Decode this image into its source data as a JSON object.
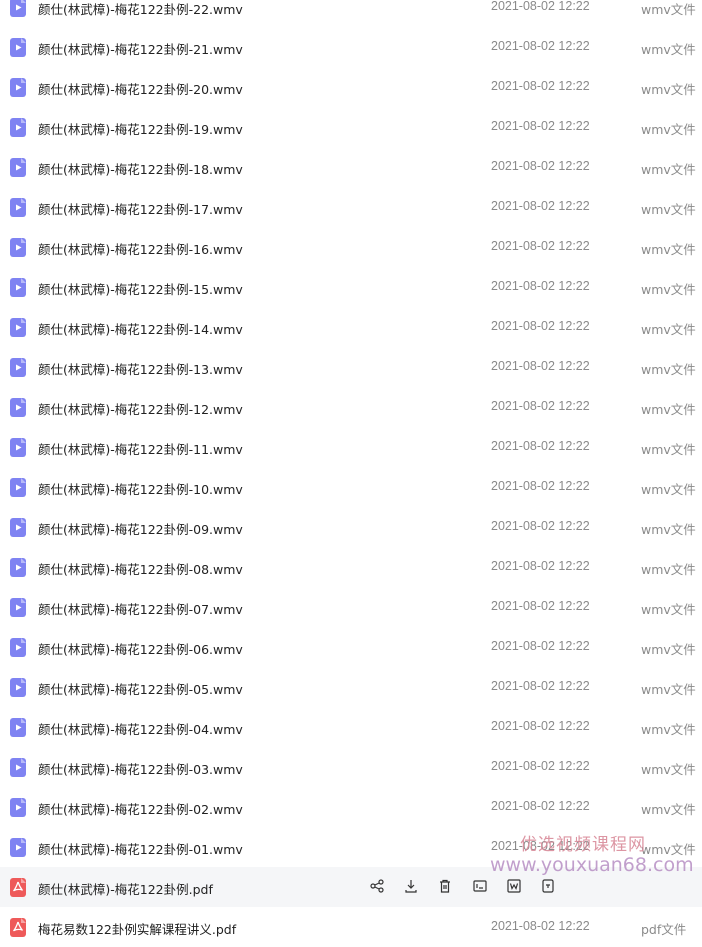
{
  "files": [
    {
      "name": "颜仕(林武樟)-梅花122卦例-22.wmv",
      "date": "2021-08-02 12:22",
      "type": "wmv文件",
      "kind": "video"
    },
    {
      "name": "颜仕(林武樟)-梅花122卦例-21.wmv",
      "date": "2021-08-02 12:22",
      "type": "wmv文件",
      "kind": "video"
    },
    {
      "name": "颜仕(林武樟)-梅花122卦例-20.wmv",
      "date": "2021-08-02 12:22",
      "type": "wmv文件",
      "kind": "video"
    },
    {
      "name": "颜仕(林武樟)-梅花122卦例-19.wmv",
      "date": "2021-08-02 12:22",
      "type": "wmv文件",
      "kind": "video"
    },
    {
      "name": "颜仕(林武樟)-梅花122卦例-18.wmv",
      "date": "2021-08-02 12:22",
      "type": "wmv文件",
      "kind": "video"
    },
    {
      "name": "颜仕(林武樟)-梅花122卦例-17.wmv",
      "date": "2021-08-02 12:22",
      "type": "wmv文件",
      "kind": "video"
    },
    {
      "name": "颜仕(林武樟)-梅花122卦例-16.wmv",
      "date": "2021-08-02 12:22",
      "type": "wmv文件",
      "kind": "video"
    },
    {
      "name": "颜仕(林武樟)-梅花122卦例-15.wmv",
      "date": "2021-08-02 12:22",
      "type": "wmv文件",
      "kind": "video"
    },
    {
      "name": "颜仕(林武樟)-梅花122卦例-14.wmv",
      "date": "2021-08-02 12:22",
      "type": "wmv文件",
      "kind": "video"
    },
    {
      "name": "颜仕(林武樟)-梅花122卦例-13.wmv",
      "date": "2021-08-02 12:22",
      "type": "wmv文件",
      "kind": "video"
    },
    {
      "name": "颜仕(林武樟)-梅花122卦例-12.wmv",
      "date": "2021-08-02 12:22",
      "type": "wmv文件",
      "kind": "video"
    },
    {
      "name": "颜仕(林武樟)-梅花122卦例-11.wmv",
      "date": "2021-08-02 12:22",
      "type": "wmv文件",
      "kind": "video"
    },
    {
      "name": "颜仕(林武樟)-梅花122卦例-10.wmv",
      "date": "2021-08-02 12:22",
      "type": "wmv文件",
      "kind": "video"
    },
    {
      "name": "颜仕(林武樟)-梅花122卦例-09.wmv",
      "date": "2021-08-02 12:22",
      "type": "wmv文件",
      "kind": "video"
    },
    {
      "name": "颜仕(林武樟)-梅花122卦例-08.wmv",
      "date": "2021-08-02 12:22",
      "type": "wmv文件",
      "kind": "video"
    },
    {
      "name": "颜仕(林武樟)-梅花122卦例-07.wmv",
      "date": "2021-08-02 12:22",
      "type": "wmv文件",
      "kind": "video"
    },
    {
      "name": "颜仕(林武樟)-梅花122卦例-06.wmv",
      "date": "2021-08-02 12:22",
      "type": "wmv文件",
      "kind": "video"
    },
    {
      "name": "颜仕(林武樟)-梅花122卦例-05.wmv",
      "date": "2021-08-02 12:22",
      "type": "wmv文件",
      "kind": "video"
    },
    {
      "name": "颜仕(林武樟)-梅花122卦例-04.wmv",
      "date": "2021-08-02 12:22",
      "type": "wmv文件",
      "kind": "video"
    },
    {
      "name": "颜仕(林武樟)-梅花122卦例-03.wmv",
      "date": "2021-08-02 12:22",
      "type": "wmv文件",
      "kind": "video"
    },
    {
      "name": "颜仕(林武樟)-梅花122卦例-02.wmv",
      "date": "2021-08-02 12:22",
      "type": "wmv文件",
      "kind": "video"
    },
    {
      "name": "颜仕(林武樟)-梅花122卦例-01.wmv",
      "date": "2021-08-02 12:22",
      "type": "wmv文件",
      "kind": "video"
    },
    {
      "name": "颜仕(林武樟)-梅花122卦例.pdf",
      "date": "",
      "type": "",
      "kind": "pdf",
      "hovered": true
    },
    {
      "name": "梅花易数122卦例实解课程讲义.pdf",
      "date": "2021-08-02 12:22",
      "type": "pdf文件",
      "kind": "pdf"
    }
  ],
  "row_actions": [
    "share-icon",
    "download-icon",
    "delete-icon",
    "rename-icon",
    "word-convert-icon",
    "more-icon"
  ],
  "watermark": {
    "line1": "优选视频课程网",
    "line2": "www.youxuan68.com"
  },
  "colors": {
    "video_icon": "#7f83f2",
    "pdf_icon": "#ee5a5a",
    "hover_row": "#f5f6f8",
    "meta_text": "#8a8a8a"
  }
}
